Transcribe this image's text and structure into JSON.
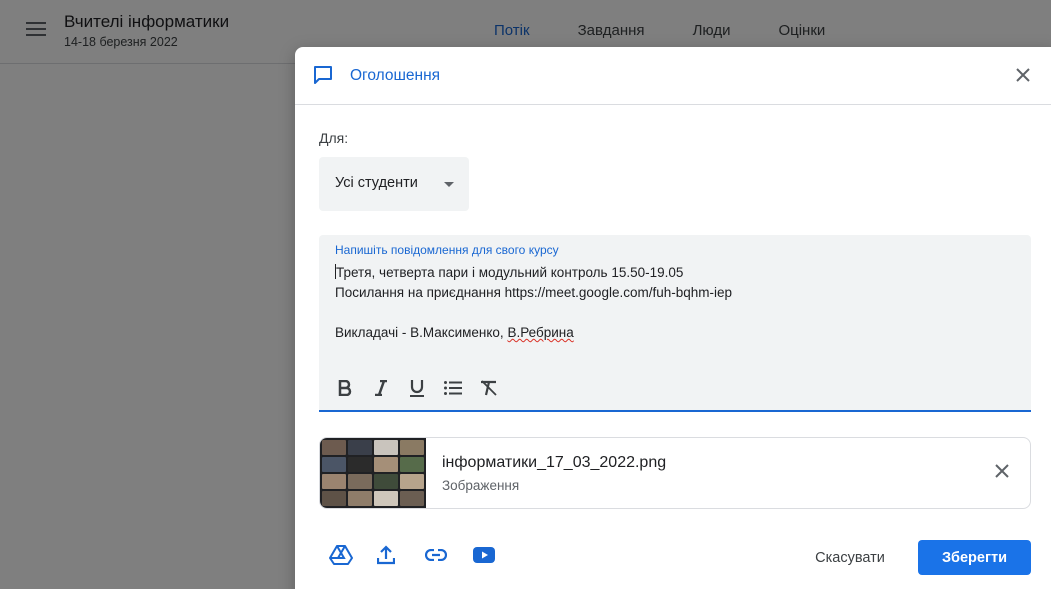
{
  "appbar": {
    "class_title": "Вчителі інформатики",
    "class_subtitle": "14-18 березня 2022",
    "tabs": [
      {
        "label": "Потік",
        "active": true
      },
      {
        "label": "Завдання",
        "active": false
      },
      {
        "label": "Люди",
        "active": false
      },
      {
        "label": "Оцінки",
        "active": false
      }
    ]
  },
  "dialog": {
    "title": "Оголошення",
    "for_label": "Для:",
    "audience": "Усі студенти",
    "composer": {
      "label": "Напишіть повідомлення для свого курсу",
      "lines": [
        "Третя, четверта пари і модульний контроль 15.50-19.05",
        "Посилання на приєднання https://meet.google.com/fuh-bqhm-iep",
        "",
        "Викладачі - В.Максименко, ",
        "В.Ребрина"
      ]
    },
    "attachment": {
      "name": "інформатики_17_03_2022.png",
      "type": "Зображення"
    },
    "cancel_label": "Скасувати",
    "save_label": "Зберегти"
  },
  "icons": {
    "menu": "menu-icon",
    "announcement": "announcement-icon",
    "close": "close-icon",
    "bold": "bold-icon",
    "italic": "italic-icon",
    "underline": "underline-icon",
    "list": "bulleted-list-icon",
    "clear_format": "clear-formatting-icon",
    "drive": "google-drive-icon",
    "upload": "upload-icon",
    "link": "link-icon",
    "youtube": "youtube-icon"
  },
  "colors": {
    "accent": "#1967d2",
    "primary_button": "#1a73e8",
    "field_bg": "#f1f3f4",
    "scrim": "rgba(0,0,0,0.5)"
  }
}
